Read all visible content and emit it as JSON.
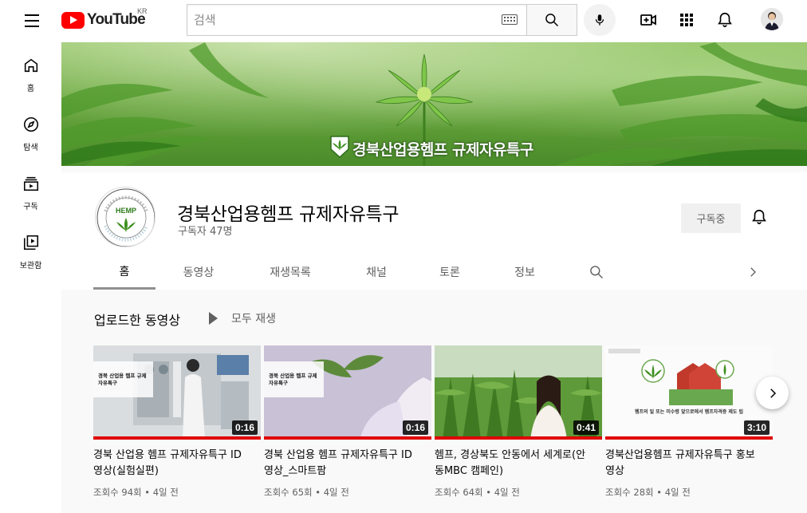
{
  "header": {
    "logo_text": "YouTube",
    "country": "KR",
    "search_placeholder": "검색"
  },
  "sidebar": {
    "items": [
      {
        "label": "홈",
        "icon": "home-icon"
      },
      {
        "label": "탐색",
        "icon": "compass-icon"
      },
      {
        "label": "구독",
        "icon": "subscriptions-icon"
      },
      {
        "label": "보관함",
        "icon": "library-icon"
      }
    ]
  },
  "banner": {
    "title": "경북산업용헴프 규제자유특구"
  },
  "channel": {
    "name": "경북산업용헴프 규제자유특구",
    "subscribers": "구독자 47명",
    "subscribe_label": "구독중",
    "avatar_text": "HEMP"
  },
  "tabs": [
    {
      "label": "홈",
      "active": true
    },
    {
      "label": "동영상",
      "active": false
    },
    {
      "label": "재생목록",
      "active": false
    },
    {
      "label": "채널",
      "active": false
    },
    {
      "label": "토론",
      "active": false
    },
    {
      "label": "정보",
      "active": false
    }
  ],
  "section": {
    "title": "업로드한 동영상",
    "play_all": "모두 재생"
  },
  "videos": [
    {
      "title": "경북 산업용 헴프 규제자유특구 ID영상(실험실편)",
      "meta": "조회수 94회 • 4일 전",
      "duration": "0:16",
      "overlay": "경북 산업용 헴프 규제자유특구",
      "watched": 1.0
    },
    {
      "title": "경북 산업용 헴프 규제자유특구 ID영상_스마트팜",
      "meta": "조회수 65회 • 4일 전",
      "duration": "0:16",
      "overlay": "경북 산업용 헴프 규제자유특구",
      "watched": 1.0
    },
    {
      "title": "헴프, 경상북도 안동에서 세계로(안동MBC 캠페인)",
      "meta": "조회수 64회 • 4일 전",
      "duration": "0:41",
      "overlay": "",
      "watched": 1.0
    },
    {
      "title": "경북산업용헴프 규제자유특구 홍보영상",
      "meta": "조회수 28회 • 4일 전",
      "duration": "3:10",
      "overlay": "헴프의 일 또는 미수령 앞으로에서 헴프자격증 제도 됩",
      "watched": 1.0
    }
  ],
  "colors": {
    "accent": "#ff0000",
    "progress": "#e00000"
  }
}
